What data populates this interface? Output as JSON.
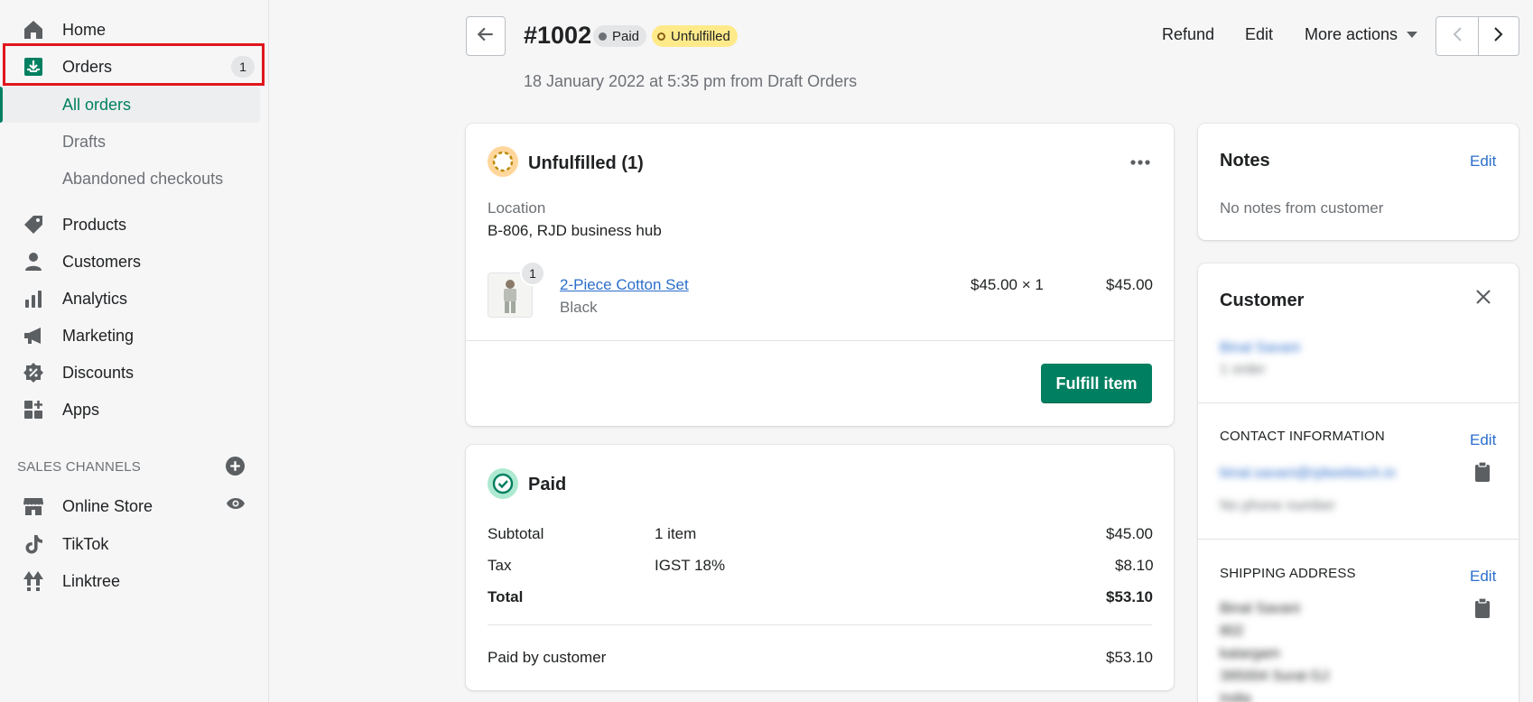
{
  "sidebar": {
    "home": "Home",
    "orders": "Orders",
    "orders_count": "1",
    "sub": {
      "all_orders": "All orders",
      "drafts": "Drafts",
      "abandoned": "Abandoned checkouts"
    },
    "products": "Products",
    "customers": "Customers",
    "analytics": "Analytics",
    "marketing": "Marketing",
    "discounts": "Discounts",
    "apps": "Apps",
    "sales_channels_title": "SALES CHANNELS",
    "channels": {
      "online_store": "Online Store",
      "tiktok": "TikTok",
      "linktree": "Linktree"
    }
  },
  "header": {
    "order_number": "#1002",
    "payment_status": "Paid",
    "fulfillment_status": "Unfulfilled",
    "subtitle": "18 January 2022 at 5:35 pm from Draft Orders",
    "refund": "Refund",
    "edit": "Edit",
    "more_actions": "More actions"
  },
  "fulfillment_card": {
    "title": "Unfulfilled (1)",
    "location_label": "Location",
    "location_value": "B-806, RJD business hub",
    "item": {
      "name": "2-Piece Cotton Set",
      "variant": "Black",
      "quantity_badge": "1",
      "unit_price": "$45.00 × 1",
      "total": "$45.00"
    },
    "fulfill_button": "Fulfill item"
  },
  "payment_card": {
    "title": "Paid",
    "rows": [
      {
        "label": "Subtotal",
        "detail": "1 item",
        "amount": "$45.00"
      },
      {
        "label": "Tax",
        "detail": "IGST 18%",
        "amount": "$8.10"
      },
      {
        "label": "Total",
        "detail": "",
        "amount": "$53.10"
      }
    ],
    "paid_by_label": "Paid by customer",
    "paid_by_amount": "$53.10"
  },
  "notes_card": {
    "title": "Notes",
    "edit": "Edit",
    "body": "No notes from customer"
  },
  "customer_card": {
    "title": "Customer",
    "name": "Binal Savani",
    "orders": "1 order",
    "contact_title": "CONTACT INFORMATION",
    "contact_edit": "Edit",
    "email": "binal.savani@rjdwebtech.in",
    "phone": "No phone number",
    "shipping_title": "SHIPPING ADDRESS",
    "shipping_edit": "Edit",
    "address_lines": [
      "Binal Savani",
      "802",
      "katargam",
      "395004 Surat GJ",
      "India"
    ]
  },
  "colors": {
    "accent": "#008060",
    "link": "#2c6ecb",
    "highlight": "#e0161c",
    "unfulfilled_pill": "#ffea8a"
  },
  "icons": [
    "home-icon",
    "orders-icon",
    "tag-icon",
    "person-icon",
    "bar-chart-icon",
    "megaphone-icon",
    "discount-icon",
    "apps-icon",
    "plus-circle-icon",
    "store-icon",
    "eye-icon",
    "tiktok-icon",
    "linktree-icon",
    "arrow-left-icon",
    "chevron-left-icon",
    "chevron-right-icon",
    "caret-down-icon",
    "more-horizontal-icon",
    "close-icon",
    "clipboard-icon"
  ]
}
